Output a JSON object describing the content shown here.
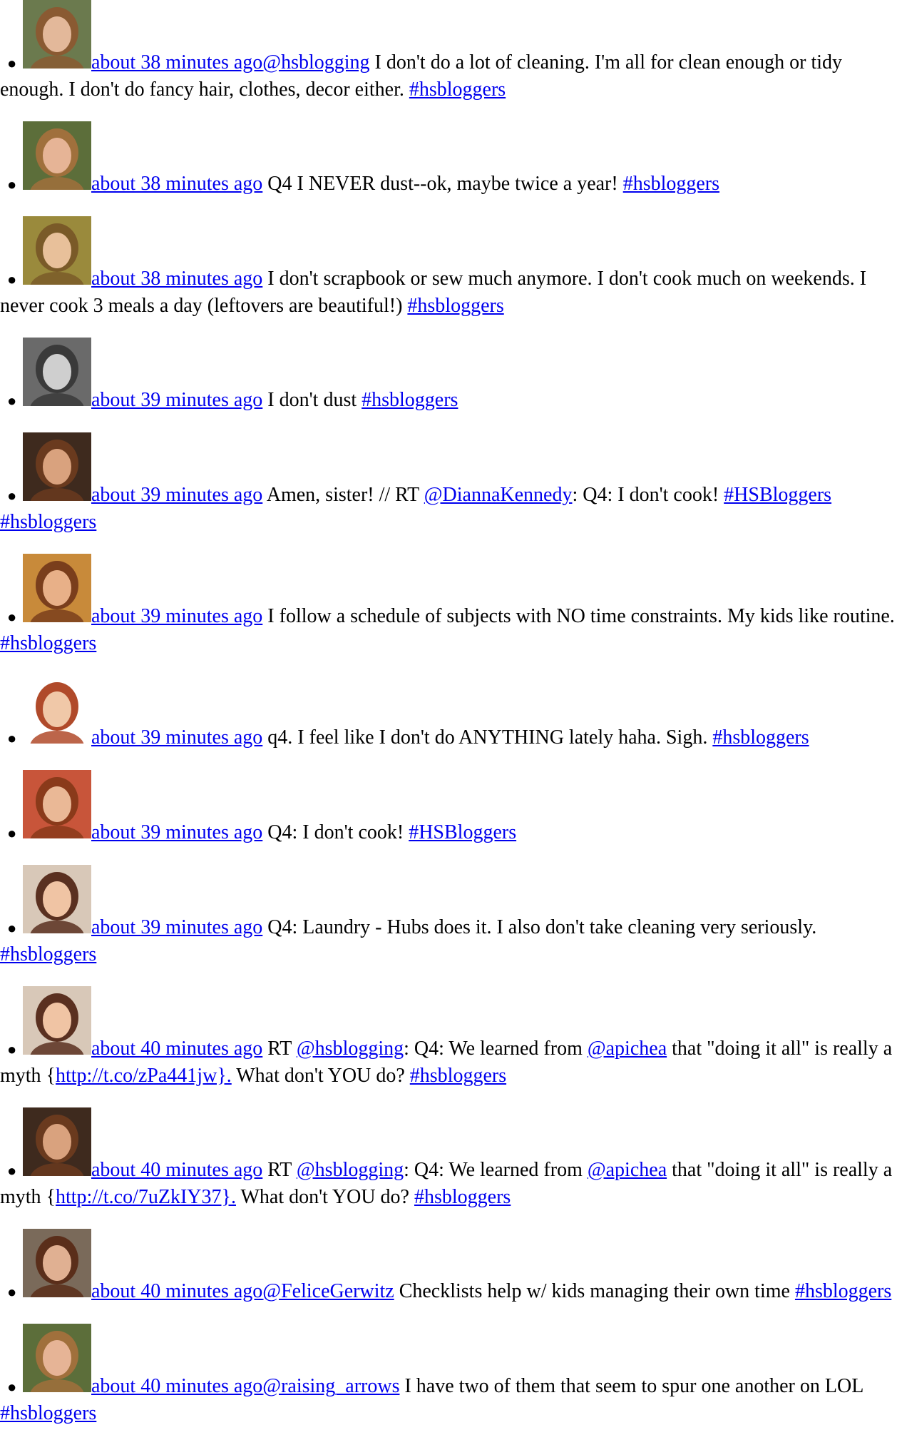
{
  "tweets": [
    {
      "time": "about 38 minutes ago",
      "parts": [
        {
          "link": "@hsblogging"
        },
        {
          "text": " I don't do a lot of cleaning. I'm all for clean enough or tidy enough. I don't do fancy hair, clothes, decor either. "
        },
        {
          "link": "#hsbloggers"
        }
      ],
      "avatar": {
        "bg": "#6b7a4e",
        "skin": "#e3b89a",
        "hair": "#8a5a32"
      }
    },
    {
      "time": "about 38 minutes ago",
      "parts": [
        {
          "text": " Q4 I NEVER dust--ok, maybe twice a year! "
        },
        {
          "link": "#hsbloggers"
        }
      ],
      "avatar": {
        "bg": "#5c6e3a",
        "skin": "#e6b496",
        "hair": "#a0703c"
      }
    },
    {
      "time": "about 38 minutes ago",
      "parts": [
        {
          "text": " I don't scrapbook or sew much anymore. I don't cook much on weekends. I never cook 3 meals a day (leftovers are beautiful!) "
        },
        {
          "link": "#hsbloggers"
        }
      ],
      "avatar": {
        "bg": "#9a8a3c",
        "skin": "#e8c09a",
        "hair": "#7a5a28"
      }
    },
    {
      "time": "about 39 minutes ago",
      "parts": [
        {
          "text": " I don't dust "
        },
        {
          "link": "#hsbloggers"
        }
      ],
      "avatar": {
        "bg": "#6a6a6a",
        "skin": "#cfcfcf",
        "hair": "#3a3a3a"
      }
    },
    {
      "time": "about 39 minutes ago",
      "parts": [
        {
          "text": " Amen, sister! // RT "
        },
        {
          "link": "@DiannaKennedy"
        },
        {
          "text": ": Q4: I don't cook! "
        },
        {
          "link": "#HSBloggers"
        },
        {
          "text": " "
        },
        {
          "link": "#hsbloggers"
        }
      ],
      "avatar": {
        "bg": "#3e2a1e",
        "skin": "#d9a27e",
        "hair": "#6a3a1e"
      }
    },
    {
      "time": "about 39 minutes ago",
      "parts": [
        {
          "text": " I follow a schedule of subjects with NO time constraints. My kids like routine. "
        },
        {
          "link": "#hsbloggers"
        }
      ],
      "avatar": {
        "bg": "#c88a3a",
        "skin": "#e8b088",
        "hair": "#7a3e1c"
      }
    },
    {
      "time": "about 39 minutes ago",
      "parts": [
        {
          "text": " q4. I feel like I don't do ANYTHING lately haha. Sigh. "
        },
        {
          "link": "#hsbloggers"
        }
      ],
      "avatar": {
        "bg": "#ffffff",
        "skin": "#f0c8a8",
        "hair": "#b04a2a"
      }
    },
    {
      "time": "about 39 minutes ago",
      "parts": [
        {
          "text": " Q4: I don't cook! "
        },
        {
          "link": "#HSBloggers"
        }
      ],
      "avatar": {
        "bg": "#c8553a",
        "skin": "#eab896",
        "hair": "#8a3a1a"
      }
    },
    {
      "time": "about 39 minutes ago",
      "parts": [
        {
          "text": " Q4: Laundry - Hubs does it. I also don't take cleaning very seriously. "
        },
        {
          "link": "#hsbloggers"
        }
      ],
      "avatar": {
        "bg": "#d8c8b8",
        "skin": "#f0c4a4",
        "hair": "#5a3020"
      }
    },
    {
      "time": "about 40 minutes ago",
      "parts": [
        {
          "text": " RT "
        },
        {
          "link": "@hsblogging"
        },
        {
          "text": ": Q4: We learned from "
        },
        {
          "link": "@apichea"
        },
        {
          "text": " that \"doing it all\" is really a myth {"
        },
        {
          "link": "http://t.co/zPa441jw}."
        },
        {
          "text": " What don't YOU do? "
        },
        {
          "link": "#hsbloggers"
        }
      ],
      "avatar": {
        "bg": "#d8c8b8",
        "skin": "#f0c4a4",
        "hair": "#5a3020"
      }
    },
    {
      "time": "about 40 minutes ago",
      "parts": [
        {
          "text": " RT "
        },
        {
          "link": "@hsblogging"
        },
        {
          "text": ": Q4: We learned from "
        },
        {
          "link": "@apichea"
        },
        {
          "text": " that \"doing it all\" is really a myth {"
        },
        {
          "link": "http://t.co/7uZkIY37}."
        },
        {
          "text": " What don't YOU do? "
        },
        {
          "link": "#hsbloggers"
        }
      ],
      "avatar": {
        "bg": "#3e2a1e",
        "skin": "#d9a27e",
        "hair": "#6a3a1e"
      }
    },
    {
      "time": "about 40 minutes ago",
      "parts": [
        {
          "link": "@FeliceGerwitz"
        },
        {
          "text": " Checklists help w/ kids managing their own time "
        },
        {
          "link": "#hsbloggers"
        }
      ],
      "avatar": {
        "bg": "#7a6a5a",
        "skin": "#e0b092",
        "hair": "#5a2e1a"
      }
    },
    {
      "time": "about 40 minutes ago",
      "parts": [
        {
          "link": "@raising_arrows"
        },
        {
          "text": " I have two of them that seem to spur one another on LOL "
        },
        {
          "link": "#hsbloggers"
        }
      ],
      "avatar": {
        "bg": "#5c6e3a",
        "skin": "#e6b496",
        "hair": "#a0703c"
      }
    }
  ]
}
